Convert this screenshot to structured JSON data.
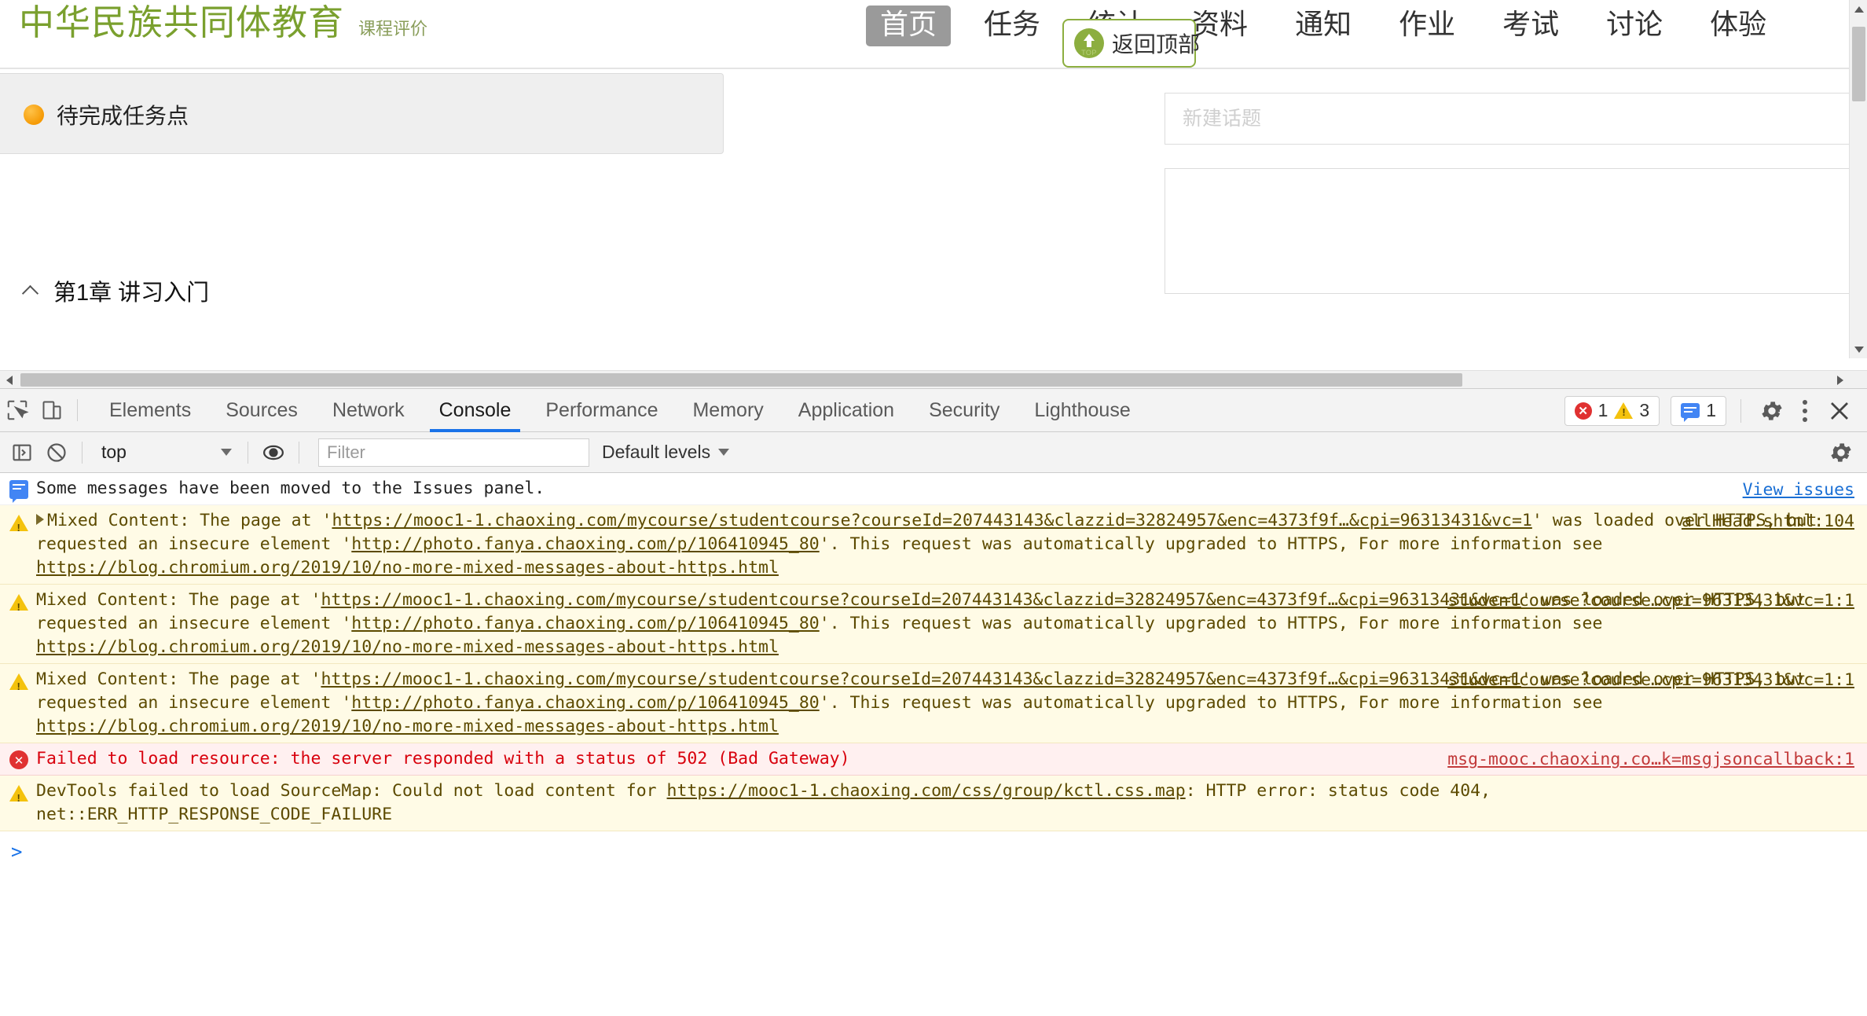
{
  "site": {
    "brand_title": "中华民族共同体教育",
    "brand_sub": "课程评价",
    "nav": [
      {
        "label": "首页",
        "active": true
      },
      {
        "label": "任务",
        "active": false
      },
      {
        "label": "统计",
        "active": false
      },
      {
        "label": "资料",
        "active": false
      },
      {
        "label": "通知",
        "active": false
      },
      {
        "label": "作业",
        "active": false
      },
      {
        "label": "考试",
        "active": false
      },
      {
        "label": "讨论",
        "active": false
      },
      {
        "label": "体验",
        "active": false
      }
    ],
    "back_to_top": {
      "label": "返回顶部",
      "icon_text": "TOP",
      "accent": "#8cae3f"
    },
    "task_panel": {
      "label": "待完成任务点",
      "dot_color": "#f5a010"
    },
    "chapter": {
      "title": "第1章 讲习入门"
    },
    "discussion": {
      "topic_placeholder": "新建话题",
      "topic_value": ""
    }
  },
  "devtools": {
    "inspect_icon": "inspect-element-icon",
    "device_icon": "device-toolbar-icon",
    "tabs": [
      {
        "label": "Elements",
        "active": false
      },
      {
        "label": "Sources",
        "active": false
      },
      {
        "label": "Network",
        "active": false
      },
      {
        "label": "Console",
        "active": true
      },
      {
        "label": "Performance",
        "active": false
      },
      {
        "label": "Memory",
        "active": false
      },
      {
        "label": "Application",
        "active": false
      },
      {
        "label": "Security",
        "active": false
      },
      {
        "label": "Lighthouse",
        "active": false
      }
    ],
    "counters": {
      "errors": "1",
      "warnings": "3",
      "messages": "1"
    },
    "settings_icon": "gear-icon",
    "more_icon": "kebab-menu-icon",
    "close_icon": "close-icon",
    "filterbar": {
      "sidebar_icon": "console-sidebar-icon",
      "clear_icon": "clear-console-icon",
      "context": "top",
      "eye_icon": "live-expression-icon",
      "filter_placeholder": "Filter",
      "filter_value": "",
      "levels": "Default levels",
      "settings_icon": "console-settings-icon"
    },
    "console": {
      "view_issues": "View issues",
      "prompt": ">",
      "messages": [
        {
          "level": "info",
          "icon": "info-message-icon",
          "text": "Some messages have been moved to the Issues panel.",
          "source": ""
        },
        {
          "level": "warn",
          "icon": "warning-icon",
          "expandable": true,
          "text_parts": [
            {
              "t": "Mixed Content: The page at '",
              "link": false
            },
            {
              "t": "https://mooc1-1.chaoxing.com/mycourse/studentcourse?courseId=207443143&clazzid=32824957&enc=4373f9f…&cpi=9631",
              "link": true
            },
            {
              "t": "3431&vc=1",
              "link": true
            },
            {
              "t": "' was loaded over HTTPS, but requested an insecure element '",
              "link": false
            },
            {
              "t": "http://photo.fanya.chaoxing.com/p/106410945_80",
              "link": true
            },
            {
              "t": "'. This request was automatically upgraded to HTTPS, For more information see ",
              "link": false
            },
            {
              "t": "https://blog.chromium.org/2019/10/no-more-mixed-messages-about-https.html",
              "link": true
            }
          ],
          "source": "allHead.shtml:104"
        },
        {
          "level": "warn",
          "icon": "warning-icon",
          "expandable": false,
          "text_parts": [
            {
              "t": "Mixed Content: The page at '",
              "link": false
            },
            {
              "t": "https://mooc1-1.chaoxing.com/mycourse/studentcourse?courseId=207443143&clazzid=32824957",
              "link": true
            },
            {
              "t": "&enc=4373f9f…&cpi=96313431&vc=1",
              "link": true
            },
            {
              "t": "' was loaded over HTTPS, but requested an insecure element '",
              "link": false
            },
            {
              "t": "http://photo.fanya.chaoxing.com/p/106410945_80",
              "link": true
            },
            {
              "t": "'. This request was automatically upgraded to HTTPS, For more information see ",
              "link": false
            },
            {
              "t": "https://blog.chromium.org/2019/10/no-more-mixed-messages-about-https.html",
              "link": true
            }
          ],
          "source": "studentcourse?course…cpi=96313431&vc=1:1"
        },
        {
          "level": "warn",
          "icon": "warning-icon",
          "expandable": false,
          "text_parts": [
            {
              "t": "Mixed Content: The page at '",
              "link": false
            },
            {
              "t": "https://mooc1-1.chaoxing.com/mycourse/studentcourse?courseId=207443143&clazzid=32824957",
              "link": true
            },
            {
              "t": "&enc=4373f9f…&cpi=96313431&vc=1",
              "link": true
            },
            {
              "t": "' was loaded over HTTPS, but requested an insecure element '",
              "link": false
            },
            {
              "t": "http://photo.fanya.chaoxing.com/p/106410945_80",
              "link": true
            },
            {
              "t": "'. This request was automatically upgraded to HTTPS, For more information see ",
              "link": false
            },
            {
              "t": "https://blog.chromium.org/2019/10/no-more-mixed-messages-about-https.html",
              "link": true
            }
          ],
          "source": "studentcourse?course…cpi=96313431&vc=1:1"
        },
        {
          "level": "error",
          "icon": "error-icon",
          "expandable": false,
          "text_parts": [
            {
              "t": "Failed to load resource: the server responded with a status of 502 (Bad Gateway)",
              "link": false
            }
          ],
          "source": "msg-mooc.chaoxing.co…k=msgjsoncallback:1"
        },
        {
          "level": "warn",
          "icon": "warning-icon",
          "expandable": false,
          "text_parts": [
            {
              "t": "DevTools failed to load SourceMap: Could not load content for ",
              "link": false
            },
            {
              "t": "https://mooc1-1.chaoxing.com/css/group/kctl.css.map",
              "link": true
            },
            {
              "t": ": HTTP error: status code 404, net::ERR_HTTP_RESPONSE_CODE_FAILURE",
              "link": false
            }
          ],
          "source": ""
        }
      ]
    }
  }
}
